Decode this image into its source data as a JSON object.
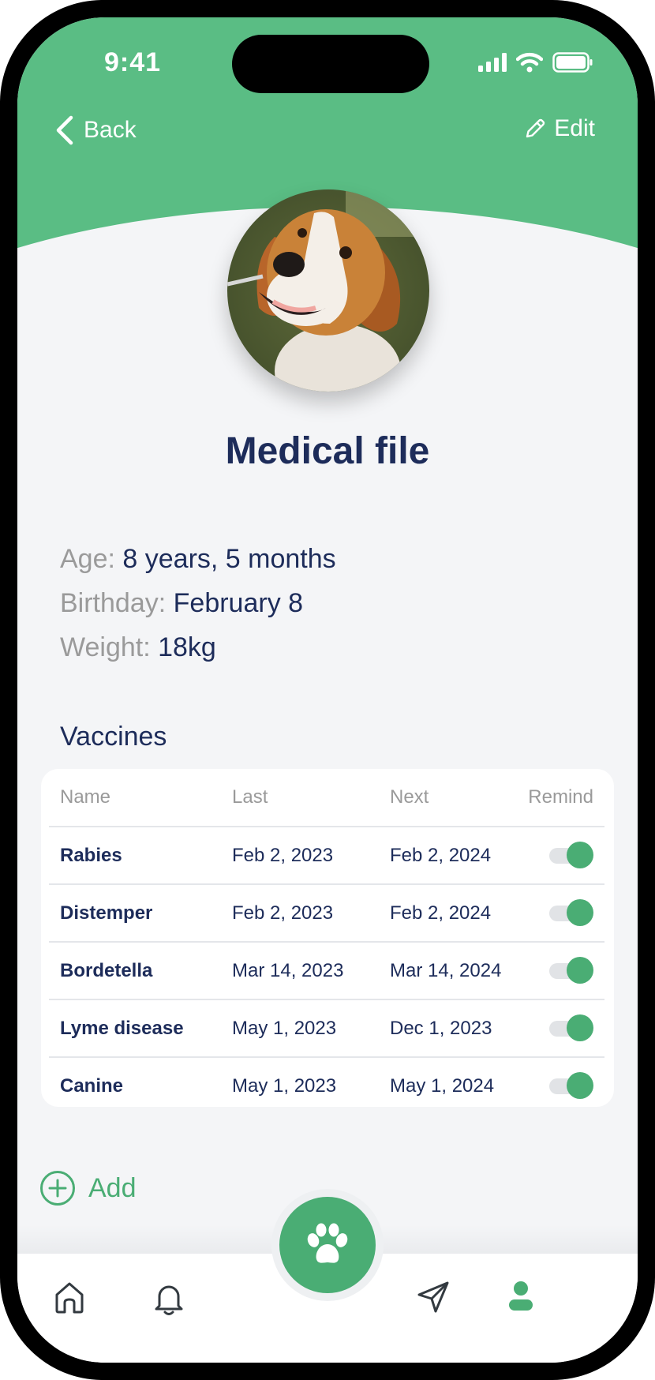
{
  "status_bar": {
    "time": "9:41"
  },
  "nav": {
    "back_label": "Back",
    "edit_label": "Edit"
  },
  "page_title": "Medical file",
  "pet_info": {
    "age_label": "Age:",
    "age_value": "8 years, 5 months",
    "birthday_label": "Birthday:",
    "birthday_value": "February 8",
    "weight_label": "Weight:",
    "weight_value": "18kg"
  },
  "vaccines": {
    "section_title": "Vaccines",
    "columns": [
      "Name",
      "Last",
      "Next",
      "Remind"
    ],
    "rows": [
      {
        "name": "Rabies",
        "last": "Feb 2, 2023",
        "next": "Feb 2, 2024",
        "remind": true
      },
      {
        "name": "Distemper",
        "last": "Feb 2, 2023",
        "next": "Feb 2, 2024",
        "remind": true
      },
      {
        "name": "Bordetella",
        "last": "Mar 14, 2023",
        "next": "Mar 14, 2024",
        "remind": true
      },
      {
        "name": "Lyme disease",
        "last": "May 1, 2023",
        "next": "Dec 1, 2023",
        "remind": true
      },
      {
        "name": "Canine",
        "last": "May 1, 2023",
        "next": "May 1, 2024",
        "remind": true
      }
    ]
  },
  "add_label": "Add",
  "tab_bar": {
    "items": [
      "home-icon",
      "bell-icon",
      "paw-icon",
      "send-icon",
      "profile-icon"
    ],
    "active": "profile-icon"
  },
  "colors": {
    "accent": "#5abd84",
    "accent_dark": "#4aad74",
    "text_dark": "#1d2c5a",
    "muted": "#9a9a9a"
  }
}
